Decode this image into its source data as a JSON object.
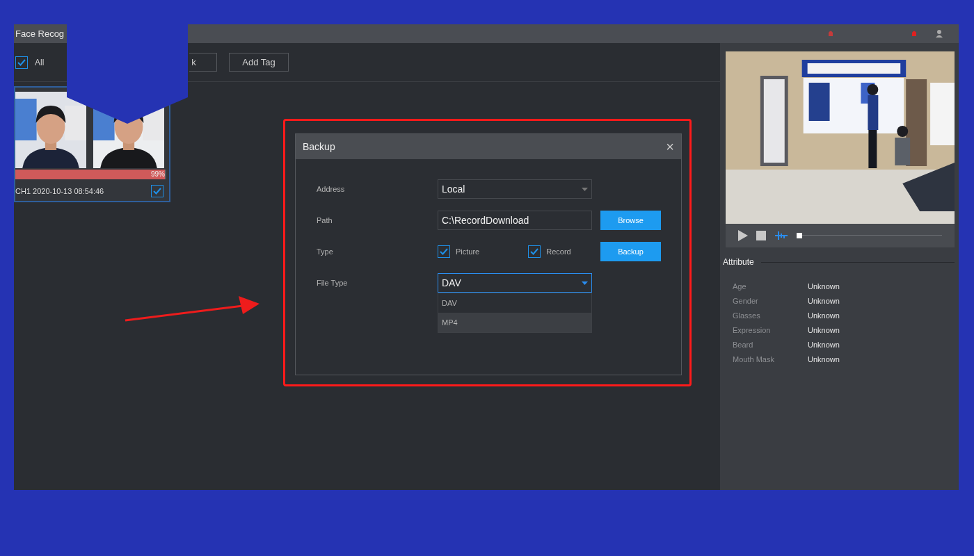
{
  "window": {
    "title": "Face Recog"
  },
  "toolbar": {
    "select_all": {
      "label": "All",
      "checked": true
    },
    "buttons": [
      "k",
      "Add Tag"
    ]
  },
  "face_card": {
    "similarity": "99%",
    "level": 0.99,
    "caption": "CH1 2020-10-13 08:54:46",
    "checked": true
  },
  "player": {
    "playback": {
      "level": 0.0
    }
  },
  "attributes": {
    "title": "Attribute",
    "rows": [
      {
        "name": "Age",
        "value": "Unknown"
      },
      {
        "name": "Gender",
        "value": "Unknown"
      },
      {
        "name": "Glasses",
        "value": "Unknown"
      },
      {
        "name": "Expression",
        "value": "Unknown"
      },
      {
        "name": "Beard",
        "value": "Unknown"
      },
      {
        "name": "Mouth Mask",
        "value": "Unknown"
      }
    ]
  },
  "dialog": {
    "title": "Backup",
    "close": "×",
    "address": {
      "label": "Address",
      "value": "Local"
    },
    "path": {
      "label": "Path",
      "value": "C:\\RecordDownload",
      "button": "Browse"
    },
    "type": {
      "label": "Type",
      "options": [
        {
          "label": "Picture",
          "checked": true
        },
        {
          "label": "Record",
          "checked": true
        }
      ],
      "button": "Backup"
    },
    "file_type": {
      "label": "File Type",
      "value": "DAV",
      "expanded": true,
      "options": [
        {
          "label": "DAV",
          "highlighted": false
        },
        {
          "label": "MP4",
          "highlighted": true
        }
      ]
    }
  }
}
